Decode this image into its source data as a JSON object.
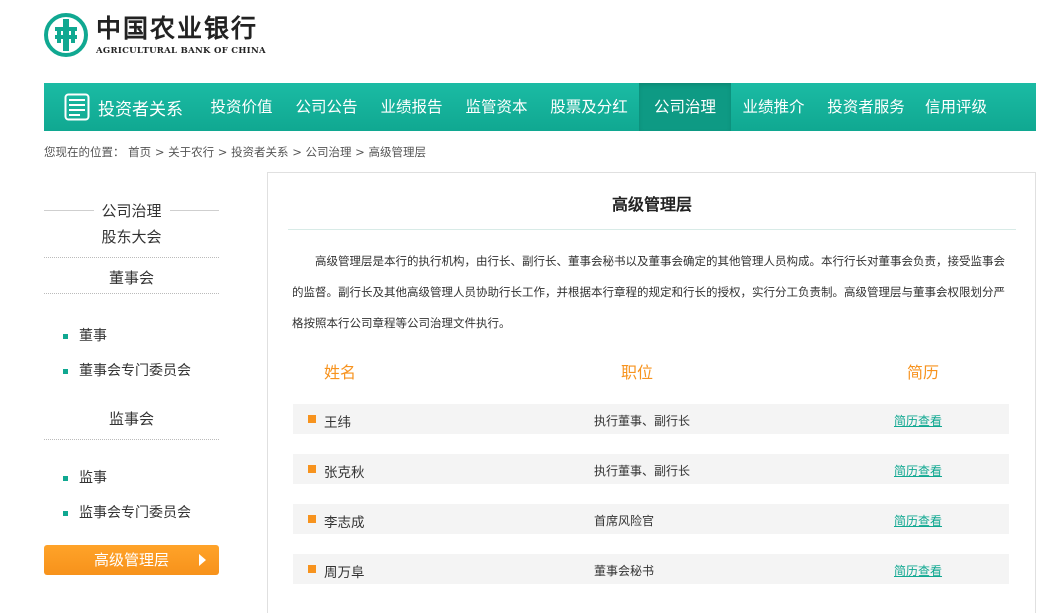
{
  "logo": {
    "cn": "中国农业银行",
    "en": "AGRICULTURAL BANK OF CHINA"
  },
  "nav": {
    "brand": "投资者关系",
    "items": [
      {
        "label": "投资价值"
      },
      {
        "label": "公司公告"
      },
      {
        "label": "业绩报告"
      },
      {
        "label": "监管资本"
      },
      {
        "label": "股票及分红"
      },
      {
        "label": "公司治理",
        "active": true
      },
      {
        "label": "业绩推介"
      },
      {
        "label": "投资者服务"
      },
      {
        "label": "信用评级"
      }
    ]
  },
  "breadcrumb": {
    "prefix": "您现在的位置：",
    "items": [
      "首页",
      "关于农行",
      "投资者关系",
      "公司治理",
      "高级管理层"
    ],
    "separator": ">"
  },
  "sidebar": {
    "heading": "公司治理",
    "shareholders": "股东大会",
    "board": "董事会",
    "board_items": [
      "董事",
      "董事会专门委员会"
    ],
    "supervisors": "监事会",
    "supervisor_items": [
      "监事",
      "监事会专门委员会"
    ],
    "active": "高级管理层"
  },
  "content": {
    "title": "高级管理层",
    "intro": "高级管理层是本行的执行机构，由行长、副行长、董事会秘书以及董事会确定的其他管理人员构成。本行行长对董事会负责，接受监事会的监督。副行长及其他高级管理人员协助行长工作，并根据本行章程的规定和行长的授权，实行分工负责制。高级管理层与董事会权限划分严格按照本行公司章程等公司治理文件执行。",
    "columns": {
      "name": "姓名",
      "position": "职位",
      "bio": "简历"
    },
    "rows": [
      {
        "name": "王纬",
        "position": "执行董事、副行长",
        "link": "简历查看"
      },
      {
        "name": "张克秋",
        "position": "执行董事、副行长",
        "link": "简历查看"
      },
      {
        "name": "李志成",
        "position": "首席风险官",
        "link": "简历查看"
      },
      {
        "name": "周万阜",
        "position": "董事会秘书",
        "link": "简历查看"
      }
    ]
  },
  "colors": {
    "brand_green": "#10a891",
    "accent_orange": "#f7931e"
  }
}
